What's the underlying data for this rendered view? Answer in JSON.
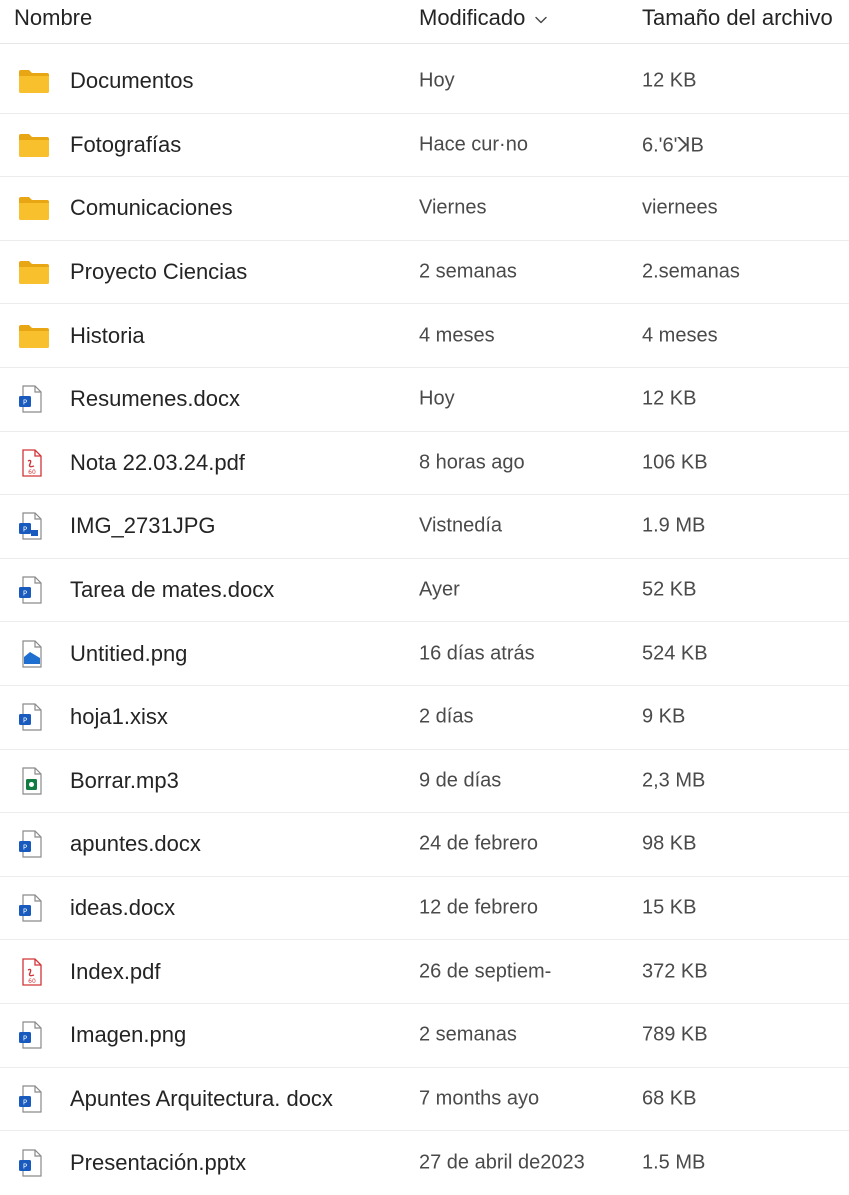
{
  "header": {
    "name_label": "Nombre",
    "modified_label": "Modificado",
    "size_label": "Tamaño del archivo",
    "sort_icon": "chevron-down-icon"
  },
  "colors": {
    "folder": "#f9c02e",
    "word": "#185abd",
    "pdf": "#d13438",
    "image": "#1f6fd1",
    "audio": "#107c41"
  },
  "files": [
    {
      "icon": "folder",
      "name": "Documentos",
      "modified": "Hoy",
      "size": "12 KB"
    },
    {
      "icon": "folder",
      "name": "Fotografías",
      "modified": "Hace cur·no",
      "size": "6.'6'ꓘB"
    },
    {
      "icon": "folder",
      "name": "Comunicaciones",
      "modified": "Viernes",
      "size": "viernees"
    },
    {
      "icon": "folder",
      "name": "Proyecto Ciencias",
      "modified": "2 semanas",
      "size": "2.semanas"
    },
    {
      "icon": "folder",
      "name": "Historia",
      "modified": "4 meses",
      "size": "4 meses"
    },
    {
      "icon": "word",
      "name": "Resumenes.docx",
      "modified": "Hoy",
      "size": "12 KB"
    },
    {
      "icon": "pdf",
      "name": "Nota 22.03.24.pdf",
      "modified": "8 horas ago",
      "size": "106 KB"
    },
    {
      "icon": "word-image",
      "name": "IMG_2731JPG",
      "modified": "Vistnedía",
      "size": "1.9 MB"
    },
    {
      "icon": "word",
      "name": "Tarea de mates.docx",
      "modified": "Ayer",
      "size": "52 KB"
    },
    {
      "icon": "image",
      "name": "Untitied.png",
      "modified": "16 días atrás",
      "size": "524 KB"
    },
    {
      "icon": "word",
      "name": "hoja1.xisx",
      "modified": "2 días",
      "size": "9 KB"
    },
    {
      "icon": "audio",
      "name": "Borrar.mp3",
      "modified": "9 de días",
      "size": "2,3 MB"
    },
    {
      "icon": "word",
      "name": "apuntes.docx",
      "modified": "24 de febrero",
      "size": "98 KB"
    },
    {
      "icon": "word",
      "name": "ideas.docx",
      "modified": "12 de febrero",
      "size": "15 KB"
    },
    {
      "icon": "pdf",
      "name": "Index.pdf",
      "modified": "26 de septiem-",
      "size": "372 KB"
    },
    {
      "icon": "word",
      "name": "Imagen.png",
      "modified": "2 semanas",
      "size": "789 KB"
    },
    {
      "icon": "word",
      "name": "Apuntes Arquitectura. docx",
      "modified": "7 months ayo",
      "size": "68 KB"
    },
    {
      "icon": "word",
      "name": "Presentación.pptx",
      "modified": "27 de abril de2023",
      "size": "1.5 MB"
    }
  ]
}
